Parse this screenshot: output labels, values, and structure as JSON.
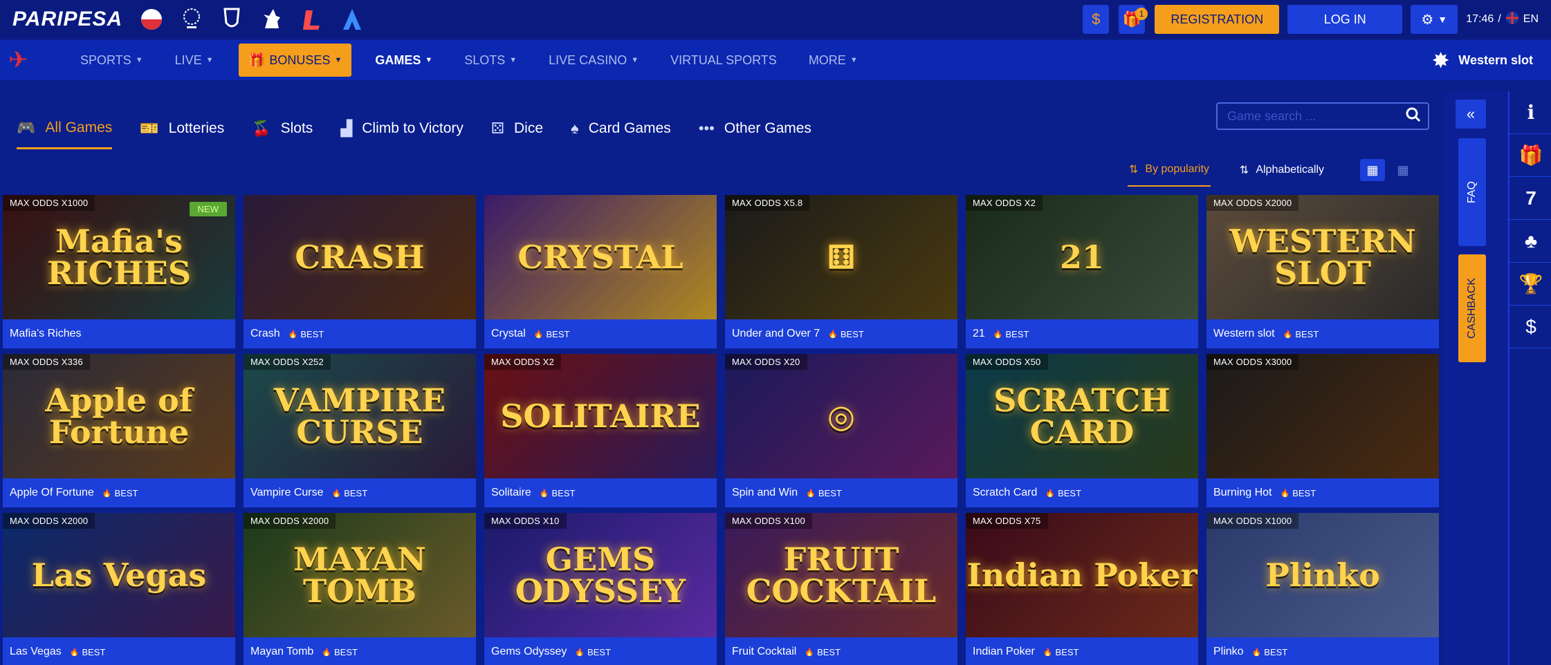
{
  "topbar": {
    "logo": "PARIPESA",
    "logos": [
      "flag-poland-icon",
      "champions-league-icon",
      "europa-league-icon",
      "premier-league-icon",
      "laliga-icon",
      "serie-a-icon"
    ],
    "registration": "REGISTRATION",
    "login": "LOG IN",
    "notifications": "1",
    "time": "17:46",
    "separator": "/",
    "lang": "EN"
  },
  "nav": {
    "items": [
      "SPORTS",
      "LIVE",
      "BONUSES",
      "GAMES",
      "SLOTS",
      "LIVE CASINO",
      "VIRTUAL SPORTS",
      "MORE"
    ],
    "current_game": "Western slot"
  },
  "categories": [
    "All Games",
    "Lotteries",
    "Slots",
    "Climb to Victory",
    "Dice",
    "Card Games",
    "Other Games"
  ],
  "search": {
    "placeholder": "Game search ..."
  },
  "sort": {
    "popularity": "By popularity",
    "alphabetical": "Alphabetically"
  },
  "side": {
    "faq": "FAQ",
    "cashback": "CASHBACK",
    "seven": "7"
  },
  "best_label": "BEST",
  "new_label": "NEW",
  "games": [
    {
      "name": "Mafia's Riches",
      "odds": "MAX ODDS X1000",
      "best": false,
      "new": true,
      "art": "Mafia's RICHES"
    },
    {
      "name": "Crash",
      "odds": "",
      "best": true,
      "new": false,
      "art": "CRASH"
    },
    {
      "name": "Crystal",
      "odds": "",
      "best": true,
      "new": false,
      "art": "CRYSTAL"
    },
    {
      "name": "Under and Over 7",
      "odds": "MAX ODDS X5.8",
      "best": true,
      "new": false,
      "art": "⚅"
    },
    {
      "name": "21",
      "odds": "MAX ODDS X2",
      "best": true,
      "new": false,
      "art": "21"
    },
    {
      "name": "Western slot",
      "odds": "MAX ODDS X2000",
      "best": true,
      "new": false,
      "art": "WESTERN SLOT"
    },
    {
      "name": "Apple Of Fortune",
      "odds": "MAX ODDS X336",
      "best": true,
      "new": false,
      "art": "Apple of Fortune"
    },
    {
      "name": "Vampire Curse",
      "odds": "MAX ODDS X252",
      "best": true,
      "new": false,
      "art": "VAMPIRE CURSE"
    },
    {
      "name": "Solitaire",
      "odds": "MAX ODDS X2",
      "best": true,
      "new": false,
      "art": "SOLITAIRE"
    },
    {
      "name": "Spin and Win",
      "odds": "MAX ODDS X20",
      "best": true,
      "new": false,
      "art": "◎"
    },
    {
      "name": "Scratch Card",
      "odds": "MAX ODDS X50",
      "best": true,
      "new": false,
      "art": "SCRATCH CARD"
    },
    {
      "name": "Burning Hot",
      "odds": "MAX ODDS X3000",
      "best": true,
      "new": false,
      "art": ""
    },
    {
      "name": "Las Vegas",
      "odds": "MAX ODDS X2000",
      "best": true,
      "new": false,
      "art": "Las Vegas"
    },
    {
      "name": "Mayan Tomb",
      "odds": "MAX ODDS X2000",
      "best": true,
      "new": false,
      "art": "MAYAN TOMB"
    },
    {
      "name": "Gems Odyssey",
      "odds": "MAX ODDS X10",
      "best": true,
      "new": false,
      "art": "GEMS ODYSSEY"
    },
    {
      "name": "Fruit Cocktail",
      "odds": "MAX ODDS X100",
      "best": true,
      "new": false,
      "art": "FRUIT COCKTAIL"
    },
    {
      "name": "Indian Poker",
      "odds": "MAX ODDS X75",
      "best": true,
      "new": false,
      "art": "Indian Poker"
    },
    {
      "name": "Plinko",
      "odds": "MAX ODDS X1000",
      "best": true,
      "new": false,
      "art": "Plinko"
    }
  ],
  "colors": {
    "accent": "#f59e1b",
    "bg": "#0a1e8c",
    "card": "#1b3fd8"
  }
}
